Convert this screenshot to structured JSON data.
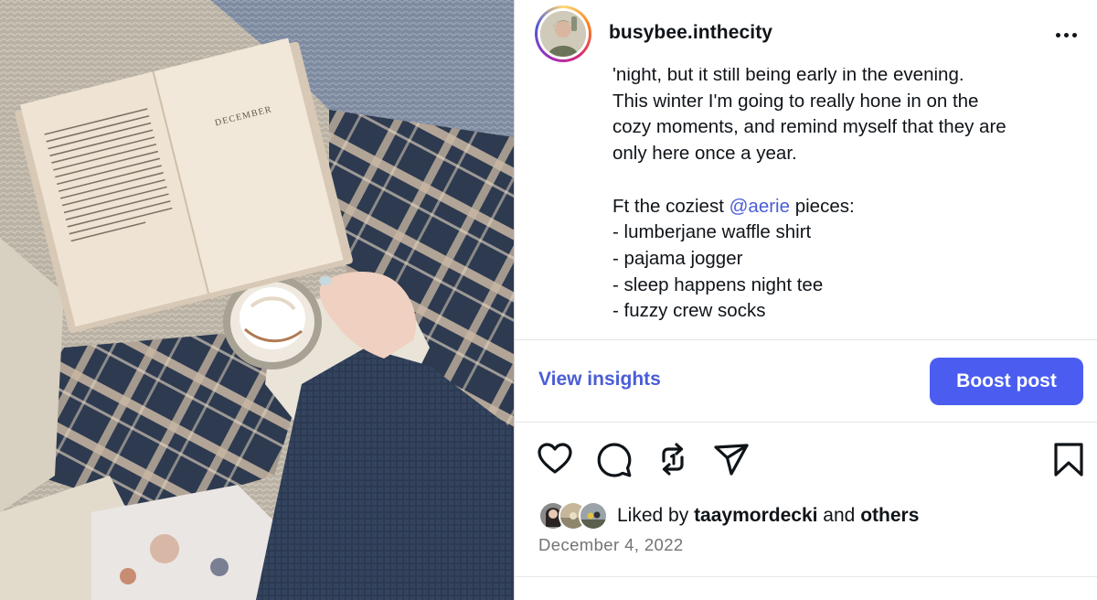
{
  "post": {
    "username": "busybee.inthecity",
    "more_icon": "more-horizontal-icon",
    "caption_lines": {
      "l1": "'night, but it still being early in the evening.",
      "l2": "This winter I'm going to really hone in on the",
      "l3": "cozy moments, and remind myself that they are",
      "l4": "only here once a year.",
      "l6_prefix": "Ft the coziest ",
      "l6_mention": "@aerie",
      "l6_suffix": " pieces:",
      "l7": "- lumberjane waffle shirt",
      "l8": "- pajama jogger",
      "l9": "- sleep happens night tee",
      "l10": "- fuzzy crew socks"
    },
    "book_page_heading": "DECEMBER"
  },
  "insights": {
    "view_label": "View insights",
    "boost_label": "Boost post"
  },
  "actions": {
    "like_icon": "heart-icon",
    "comment_icon": "comment-icon",
    "repost_icon": "repost-icon",
    "share_icon": "send-icon",
    "save_icon": "bookmark-icon"
  },
  "likes": {
    "prefix": "Liked by ",
    "user": "taaymordecki",
    "middle": " and ",
    "others": "others"
  },
  "date": "December 4, 2022",
  "colors": {
    "accent": "#4a5df0",
    "link": "#4a5dd6",
    "muted": "#737373"
  }
}
